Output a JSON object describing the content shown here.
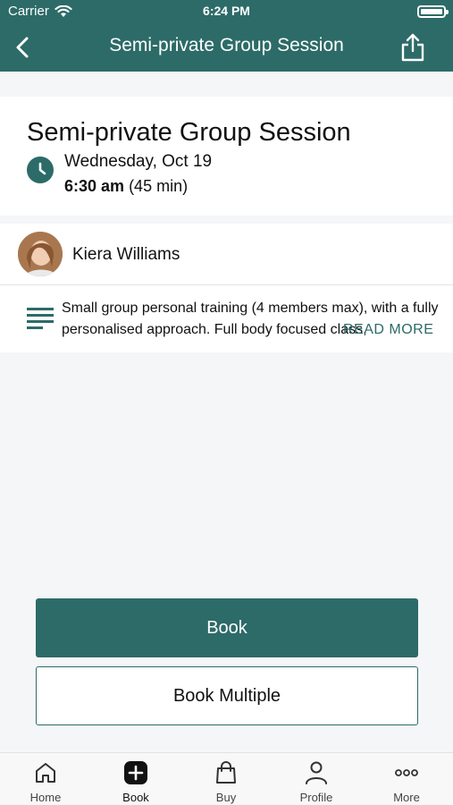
{
  "status_bar": {
    "carrier": "Carrier",
    "time": "6:24 PM"
  },
  "header": {
    "title": "Semi-private Group Session"
  },
  "session": {
    "title": "Semi-private Group Session",
    "date": "Wednesday, Oct 19",
    "start_time": "6:30 am",
    "duration": "(45 min)"
  },
  "instructor": {
    "name": "Kiera Williams"
  },
  "description": {
    "text": "Small group personal training (4 members max), with a fully personalised approach. Full body focused class,",
    "read_more": "READ MORE"
  },
  "actions": {
    "book": "Book",
    "book_multiple": "Book Multiple"
  },
  "tabs": [
    {
      "label": "Home",
      "icon": "home-icon"
    },
    {
      "label": "Book",
      "icon": "plus-square-icon"
    },
    {
      "label": "Buy",
      "icon": "shopping-bag-icon"
    },
    {
      "label": "Profile",
      "icon": "person-icon"
    },
    {
      "label": "More",
      "icon": "more-dots-icon"
    }
  ],
  "colors": {
    "brand": "#2c6b68",
    "background": "#f5f6f8"
  }
}
